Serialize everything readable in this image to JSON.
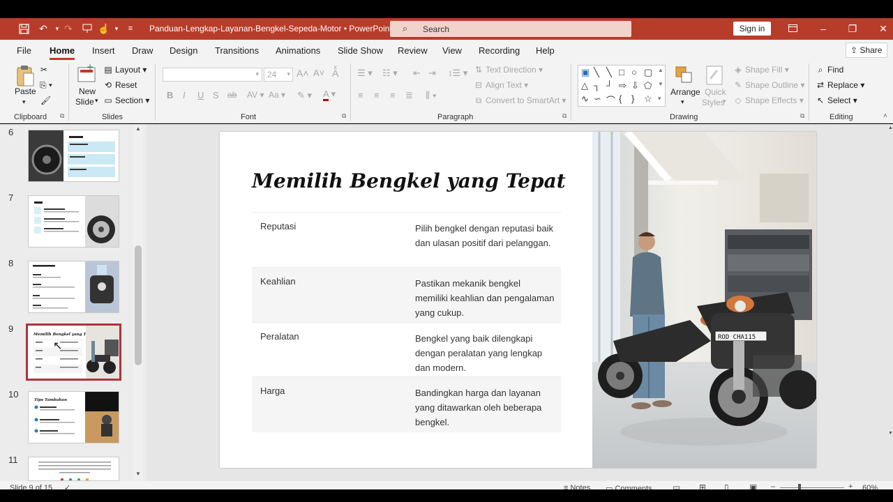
{
  "titlebar": {
    "doc_title": "Panduan-Lengkap-Layanan-Bengkel-Sepeda-Motor  •  PowerPoint",
    "search_placeholder": "Search",
    "sign_in": "Sign in",
    "bg_color": "#b83c2a"
  },
  "menu": {
    "tabs": [
      "File",
      "Home",
      "Insert",
      "Draw",
      "Design",
      "Transitions",
      "Animations",
      "Slide Show",
      "Review",
      "View",
      "Recording",
      "Help"
    ],
    "active": "Home",
    "share": "Share"
  },
  "ribbon": {
    "clipboard": {
      "label": "Clipboard",
      "paste": "Paste"
    },
    "slides": {
      "label": "Slides",
      "new_slide_1": "New",
      "new_slide_2": "Slide",
      "layout": "Layout",
      "reset": "Reset",
      "section": "Section"
    },
    "font": {
      "label": "Font",
      "size": "24"
    },
    "paragraph": {
      "label": "Paragraph",
      "text_direction": "Text Direction",
      "align_text": "Align Text",
      "convert_smartart": "Convert to SmartArt"
    },
    "drawing": {
      "label": "Drawing",
      "arrange": "Arrange",
      "quick_1": "Quick",
      "quick_2": "Styles",
      "shape_fill": "Shape Fill",
      "shape_outline": "Shape Outline",
      "shape_effects": "Shape Effects"
    },
    "editing": {
      "label": "Editing",
      "find": "Find",
      "replace": "Replace",
      "select": "Select"
    }
  },
  "thumbnails": {
    "numbers": [
      "6",
      "7",
      "8",
      "9",
      "10",
      "11"
    ],
    "selected": "9",
    "t9_title": "Memilih Bengkel yang Tepat",
    "t10_title": "Tips Tambahan"
  },
  "slide": {
    "title": "Memilih Bengkel yang Tepat",
    "rows": [
      {
        "label": "Reputasi",
        "desc": "Pilih bengkel dengan reputasi baik dan ulasan positif dari pelanggan."
      },
      {
        "label": "Keahlian",
        "desc": "Pastikan mekanik bengkel memiliki keahlian dan pengalaman yang cukup."
      },
      {
        "label": "Peralatan",
        "desc": "Bengkel yang baik dilengkapi dengan peralatan yang lengkap dan modern."
      },
      {
        "label": "Harga",
        "desc": "Bandingkan harga dan layanan yang ditawarkan oleh beberapa bengkel."
      }
    ],
    "plate": "ROD CHA115"
  },
  "status": {
    "slide_info": "Slide 9 of 15",
    "notes": "Notes",
    "comments": "Comments",
    "zoom": "60%"
  }
}
